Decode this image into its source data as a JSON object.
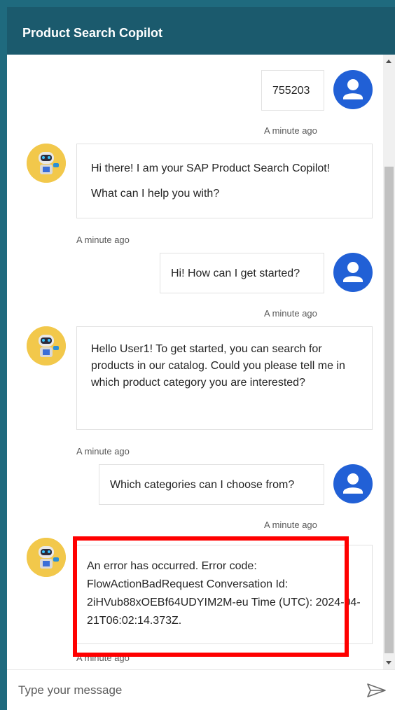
{
  "header": {
    "title": "Product Search Copilot"
  },
  "messages": [
    {
      "from": "user",
      "text": "755203",
      "time": "A minute ago"
    },
    {
      "from": "bot",
      "lines": [
        "Hi there! I am your SAP Product Search Copilot!",
        "What can I help you with?"
      ],
      "time": "A minute ago"
    },
    {
      "from": "user",
      "text": "Hi! How can I get started?",
      "time": "A minute ago"
    },
    {
      "from": "bot",
      "lines": [
        "Hello User1! To get started, you can search for products in our catalog. Could you please tell me in which product category you are interested?"
      ],
      "time": "A minute ago"
    },
    {
      "from": "user",
      "text": "Which categories can I choose from?",
      "time": "A minute ago"
    },
    {
      "from": "bot",
      "lines": [
        "An error has occurred. Error code: FlowActionBadRequest Conversation Id: 2iHVub88xOEBf64UDYIM2M-eu Time (UTC): 2024-04-21T06:02:14.373Z."
      ],
      "time": "A minute ago"
    }
  ],
  "input": {
    "placeholder": "Type your message"
  },
  "colors": {
    "header": "#1b5a6d",
    "background": "#1f6a7e",
    "user_avatar": "#2160d6",
    "highlight": "#ff0000"
  },
  "icons": {
    "user_avatar": "person-icon",
    "bot_avatar": "robot-icon",
    "send": "send-arrow-icon"
  }
}
